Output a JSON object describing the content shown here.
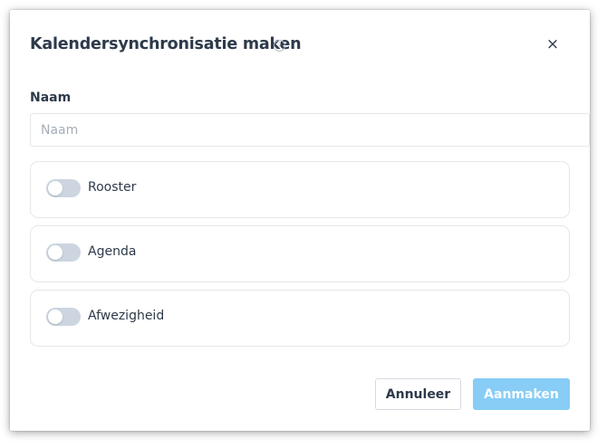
{
  "dialog": {
    "title": "Kalendersynchronisatie maken",
    "help_icon": "question-circle-icon",
    "help_glyph": "?",
    "close_icon": "close-icon",
    "close_glyph": "×"
  },
  "form": {
    "name_label": "Naam",
    "name_placeholder": "Naam",
    "name_value": "",
    "toggles": [
      {
        "label": "Rooster",
        "enabled": false
      },
      {
        "label": "Agenda",
        "enabled": false
      },
      {
        "label": "Afwezigheid",
        "enabled": false
      }
    ]
  },
  "footer": {
    "cancel_label": "Annuleer",
    "create_label": "Aanmaken",
    "create_disabled": true
  },
  "colors": {
    "primary_disabled": "#87cdf6",
    "text": "#2d3a4a",
    "toggle_off": "#ccd5e0",
    "border": "#e3e7ec"
  }
}
